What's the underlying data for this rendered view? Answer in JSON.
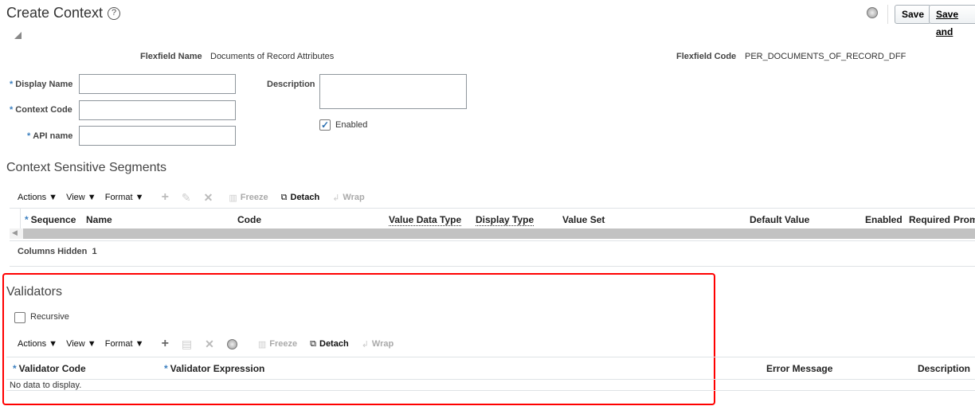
{
  "header": {
    "title": "Create Context",
    "help": "?",
    "save": "Save",
    "save_and": "Save and"
  },
  "flexfield": {
    "name_label": "Flexfield Name",
    "name_value": "Documents of Record Attributes",
    "code_label": "Flexfield Code",
    "code_value": "PER_DOCUMENTS_OF_RECORD_DFF"
  },
  "form": {
    "display_name": "Display Name",
    "context_code": "Context Code",
    "api_name": "API name",
    "description": "Description",
    "enabled": "Enabled",
    "required_mark": "*"
  },
  "segments": {
    "title": "Context Sensitive Segments",
    "toolbar": {
      "actions": "Actions",
      "view": "View",
      "format": "Format",
      "freeze": "Freeze",
      "detach": "Detach",
      "wrap": "Wrap"
    },
    "columns": [
      "Sequence",
      "Name",
      "Code",
      "Value Data Type",
      "Display Type",
      "Value Set",
      "Default Value",
      "Enabled",
      "Required",
      "Prom"
    ],
    "columns_hidden_label": "Columns Hidden",
    "columns_hidden": "1"
  },
  "validators": {
    "title": "Validators",
    "recursive": "Recursive",
    "toolbar": {
      "actions": "Actions",
      "view": "View",
      "format": "Format",
      "freeze": "Freeze",
      "detach": "Detach",
      "wrap": "Wrap"
    },
    "columns": [
      "Validator Code",
      "Validator Expression",
      "Error Message",
      "Description"
    ],
    "empty": "No data to display."
  },
  "colors": {
    "highlight": "#ff0000",
    "accent": "#3b7fbf"
  }
}
